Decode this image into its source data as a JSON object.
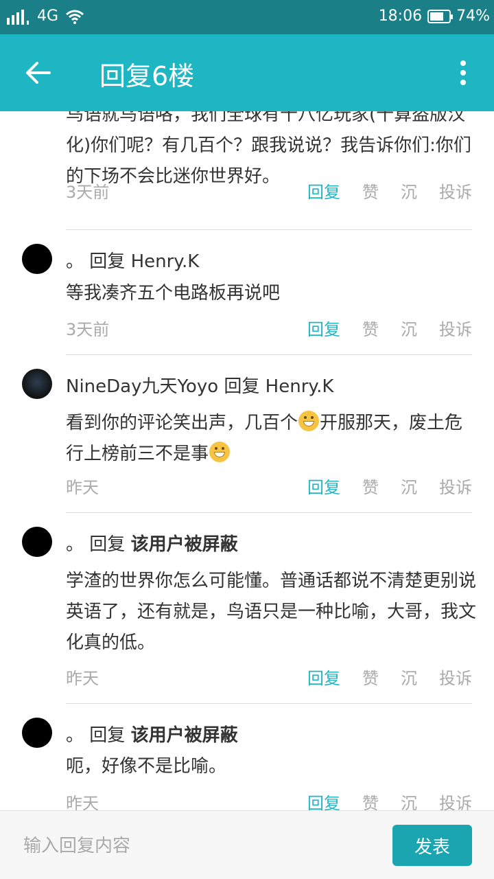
{
  "status_bar": {
    "network": "4G",
    "time": "18:06",
    "battery": "74%",
    "battery_level": 0.74
  },
  "app_bar": {
    "title": "回复6楼"
  },
  "posts": [
    {
      "text": "鸟语就鸟语咯，我们全球有十八亿玩家(十算盗版汉化)你们呢？有几百个？跟我说说？我告诉你们:你们的下场不会比迷你世界好。",
      "time": "3天前",
      "actions": [
        "回复",
        "赞",
        "沉",
        "投诉"
      ]
    },
    {
      "user": "。",
      "reply_word": "回复",
      "reply_to": "Henry.K",
      "text": "等我凑齐五个电路板再说吧",
      "time": "3天前",
      "actions": [
        "回复",
        "赞",
        "沉",
        "投诉"
      ]
    },
    {
      "user": "NineDay九天Yoyo",
      "reply_word": "回复",
      "reply_to": "Henry.K",
      "text_parts": [
        "看到你的评论笑出声，几百个",
        "开服那天，废土危行上榜前三不是事"
      ],
      "time": "昨天",
      "actions": [
        "回复",
        "赞",
        "沉",
        "投诉"
      ]
    },
    {
      "user": "。",
      "reply_word": "回复",
      "reply_to": "该用户被屏蔽",
      "text": "学渣的世界你怎么可能懂。普通话都说不清楚更别说英语了，还有就是，鸟语只是一种比喻，大哥，我文化真的低。",
      "time": "昨天",
      "actions": [
        "回复",
        "赞",
        "沉",
        "投诉"
      ]
    },
    {
      "user": "。",
      "reply_word": "回复",
      "reply_to": "该用户被屏蔽",
      "text": "呃，好像不是比喻。",
      "time": "昨天",
      "actions": [
        "回复",
        "赞",
        "沉",
        "投诉"
      ]
    }
  ],
  "reply_bar": {
    "placeholder": "输入回复内容",
    "send_label": "发表"
  }
}
